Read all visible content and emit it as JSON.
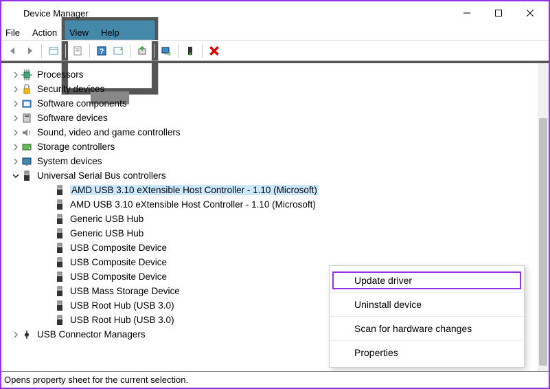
{
  "window": {
    "title": "Device Manager"
  },
  "menubar": [
    "File",
    "Action",
    "View",
    "Help"
  ],
  "toolbar_icons": [
    "back-arrow-icon",
    "forward-arrow-icon",
    "show-hidden-icon",
    "properties-sheet-icon",
    "help-icon",
    "refresh-icon",
    "update-driver-icon",
    "uninstall-icon",
    "scan-hardware-icon",
    "disable-icon"
  ],
  "tree": [
    {
      "label": "Processors",
      "icon": "processor",
      "expanded": false,
      "children": []
    },
    {
      "label": "Security devices",
      "icon": "security",
      "expanded": false,
      "children": []
    },
    {
      "label": "Software components",
      "icon": "component",
      "expanded": false,
      "children": []
    },
    {
      "label": "Software devices",
      "icon": "software",
      "expanded": false,
      "children": []
    },
    {
      "label": "Sound, video and game controllers",
      "icon": "sound",
      "expanded": false,
      "children": []
    },
    {
      "label": "Storage controllers",
      "icon": "storage",
      "expanded": false,
      "children": []
    },
    {
      "label": "System devices",
      "icon": "system",
      "expanded": false,
      "children": []
    },
    {
      "label": "Universal Serial Bus controllers",
      "icon": "usb",
      "expanded": true,
      "children": [
        {
          "label": "AMD USB 3.10 eXtensible Host Controller - 1.10 (Microsoft)",
          "icon": "usb",
          "selected": true
        },
        {
          "label": "AMD USB 3.10 eXtensible Host Controller - 1.10 (Microsoft)",
          "icon": "usb"
        },
        {
          "label": "Generic USB Hub",
          "icon": "usb"
        },
        {
          "label": "Generic USB Hub",
          "icon": "usb"
        },
        {
          "label": "USB Composite Device",
          "icon": "usb"
        },
        {
          "label": "USB Composite Device",
          "icon": "usb"
        },
        {
          "label": "USB Composite Device",
          "icon": "usb"
        },
        {
          "label": "USB Mass Storage Device",
          "icon": "usb"
        },
        {
          "label": "USB Root Hub (USB 3.0)",
          "icon": "usb"
        },
        {
          "label": "USB Root Hub (USB 3.0)",
          "icon": "usb"
        }
      ]
    },
    {
      "label": "USB Connector Managers",
      "icon": "usb-connector",
      "expanded": false,
      "children": []
    }
  ],
  "context_menu": [
    {
      "label": "Update driver",
      "highlighted": true
    },
    {
      "label": "Uninstall device"
    },
    {
      "label": "Scan for hardware changes"
    },
    {
      "label": "Properties"
    }
  ],
  "statusbar": "Opens property sheet for the current selection."
}
